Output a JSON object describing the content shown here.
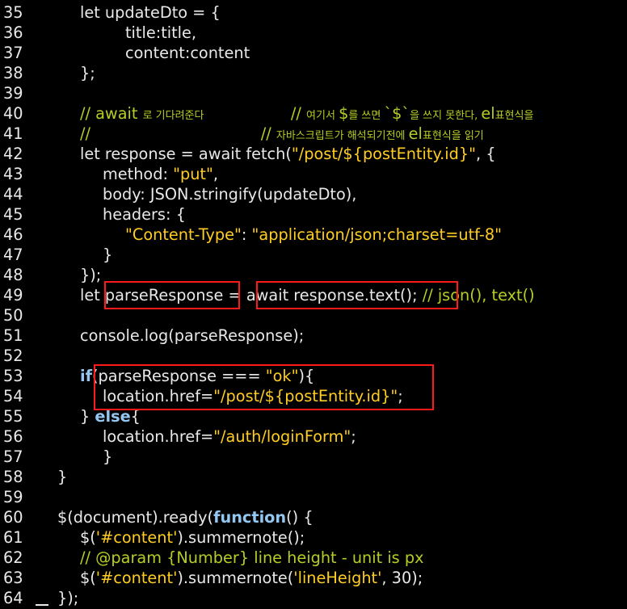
{
  "colors": {
    "background": "#000000",
    "plain": "#e8e8e8",
    "string": "#ffcd22",
    "keyword": "#93c7f2",
    "comment": "#b8cc26",
    "highlight_box": "#ff1a1a"
  },
  "lines": [
    {
      "n": "35",
      "indent": 2,
      "segs": [
        {
          "c": "pl",
          "t": "let updateDto = {"
        }
      ]
    },
    {
      "n": "36",
      "indent": 4,
      "segs": [
        {
          "c": "pl",
          "t": "title:title,"
        }
      ]
    },
    {
      "n": "37",
      "indent": 4,
      "segs": [
        {
          "c": "pl",
          "t": "content:content"
        }
      ]
    },
    {
      "n": "38",
      "indent": 2,
      "segs": [
        {
          "c": "pl",
          "t": "};"
        }
      ]
    },
    {
      "n": "39",
      "indent": 0,
      "segs": []
    },
    {
      "n": "40",
      "indent": 2,
      "segs": [
        {
          "c": "cm",
          "t": "// await "
        },
        {
          "c": "cm ko",
          "t": "로 기다려준다                          "
        },
        {
          "c": "cm",
          "t": "// "
        },
        {
          "c": "cm ko",
          "t": "여기서 "
        },
        {
          "c": "cm",
          "t": "$"
        },
        {
          "c": "cm ko",
          "t": "를 쓰면 "
        },
        {
          "c": "cm",
          "t": "`$`"
        },
        {
          "c": "cm ko",
          "t": "을 쓰지 못한다, "
        },
        {
          "c": "cm",
          "t": "el"
        },
        {
          "c": "cm ko",
          "t": "표현식을"
        }
      ]
    },
    {
      "n": "41",
      "indent": 2,
      "segs": [
        {
          "c": "cm",
          "t": "//"
        },
        {
          "c": "cm ko",
          "t": "                                                   "
        },
        {
          "c": "cm",
          "t": "// "
        },
        {
          "c": "cm ko",
          "t": "자바스크립트가 해석되기전에 "
        },
        {
          "c": "cm",
          "t": "el"
        },
        {
          "c": "cm ko",
          "t": "표현식을 읽기"
        }
      ]
    },
    {
      "n": "42",
      "indent": 2,
      "segs": [
        {
          "c": "pl",
          "t": "let response = await fetch("
        },
        {
          "c": "str",
          "t": "\"/post/${postEntity.id}\""
        },
        {
          "c": "pl",
          "t": ", {"
        }
      ]
    },
    {
      "n": "43",
      "indent": 3,
      "segs": [
        {
          "c": "pl",
          "t": "method: "
        },
        {
          "c": "str",
          "t": "\"put\""
        },
        {
          "c": "pl",
          "t": ","
        }
      ]
    },
    {
      "n": "44",
      "indent": 3,
      "segs": [
        {
          "c": "pl",
          "t": "body: JSON.stringify(updateDto),"
        }
      ]
    },
    {
      "n": "45",
      "indent": 3,
      "segs": [
        {
          "c": "pl",
          "t": "headers: {"
        }
      ]
    },
    {
      "n": "46",
      "indent": 4,
      "segs": [
        {
          "c": "str",
          "t": "\"Content-Type\""
        },
        {
          "c": "pl",
          "t": ": "
        },
        {
          "c": "str",
          "t": "\"application/json;charset=utf-8\""
        }
      ]
    },
    {
      "n": "47",
      "indent": 3,
      "segs": [
        {
          "c": "pl",
          "t": "}"
        }
      ]
    },
    {
      "n": "48",
      "indent": 2,
      "segs": [
        {
          "c": "pl",
          "t": "});"
        }
      ]
    },
    {
      "n": "49",
      "indent": 2,
      "segs": [
        {
          "c": "pl",
          "t": "let parseResponse = await response.text(); "
        },
        {
          "c": "cm",
          "t": "// json(), text()"
        }
      ]
    },
    {
      "n": "50",
      "indent": 0,
      "segs": []
    },
    {
      "n": "51",
      "indent": 2,
      "segs": [
        {
          "c": "pl",
          "t": "console.log(parseResponse);"
        }
      ]
    },
    {
      "n": "52",
      "indent": 0,
      "segs": []
    },
    {
      "n": "53",
      "indent": 2,
      "segs": [
        {
          "c": "kw",
          "t": "if"
        },
        {
          "c": "pl",
          "t": "(parseResponse === "
        },
        {
          "c": "str",
          "t": "\"ok\""
        },
        {
          "c": "pl",
          "t": "){"
        }
      ]
    },
    {
      "n": "54",
      "indent": 3,
      "segs": [
        {
          "c": "pl",
          "t": "location.href="
        },
        {
          "c": "str",
          "t": "\"/post/${postEntity.id}\""
        },
        {
          "c": "pl",
          "t": ";"
        }
      ]
    },
    {
      "n": "55",
      "indent": 2,
      "segs": [
        {
          "c": "pl",
          "t": "} "
        },
        {
          "c": "kw",
          "t": "else"
        },
        {
          "c": "pl",
          "t": "{"
        }
      ]
    },
    {
      "n": "56",
      "indent": 3,
      "segs": [
        {
          "c": "pl",
          "t": "location.href="
        },
        {
          "c": "str",
          "t": "\"/auth/loginForm\""
        },
        {
          "c": "pl",
          "t": ";"
        }
      ]
    },
    {
      "n": "57",
      "indent": 3,
      "segs": [
        {
          "c": "pl",
          "t": "}"
        }
      ]
    },
    {
      "n": "58",
      "indent": 1,
      "segs": [
        {
          "c": "pl",
          "t": "}"
        }
      ]
    },
    {
      "n": "59",
      "indent": 0,
      "segs": []
    },
    {
      "n": "60",
      "indent": 1,
      "segs": [
        {
          "c": "pl",
          "t": "$(document).ready("
        },
        {
          "c": "kw",
          "t": "function"
        },
        {
          "c": "pl",
          "t": "() {"
        }
      ]
    },
    {
      "n": "61",
      "indent": 2,
      "segs": [
        {
          "c": "pl",
          "t": "$("
        },
        {
          "c": "str",
          "t": "'#content'"
        },
        {
          "c": "pl",
          "t": ").summernote();"
        }
      ]
    },
    {
      "n": "62",
      "indent": 2,
      "segs": [
        {
          "c": "cm",
          "t": "// @param {Number} line height - unit is px"
        }
      ]
    },
    {
      "n": "63",
      "indent": 2,
      "segs": [
        {
          "c": "pl",
          "t": "$("
        },
        {
          "c": "str",
          "t": "'#content'"
        },
        {
          "c": "pl",
          "t": ").summernote("
        },
        {
          "c": "str",
          "t": "'lineHeight'"
        },
        {
          "c": "pl",
          "t": ", 30);"
        }
      ]
    },
    {
      "n": "64",
      "indent": 1,
      "segs": [
        {
          "c": "pl",
          "t": "});"
        }
      ]
    }
  ]
}
